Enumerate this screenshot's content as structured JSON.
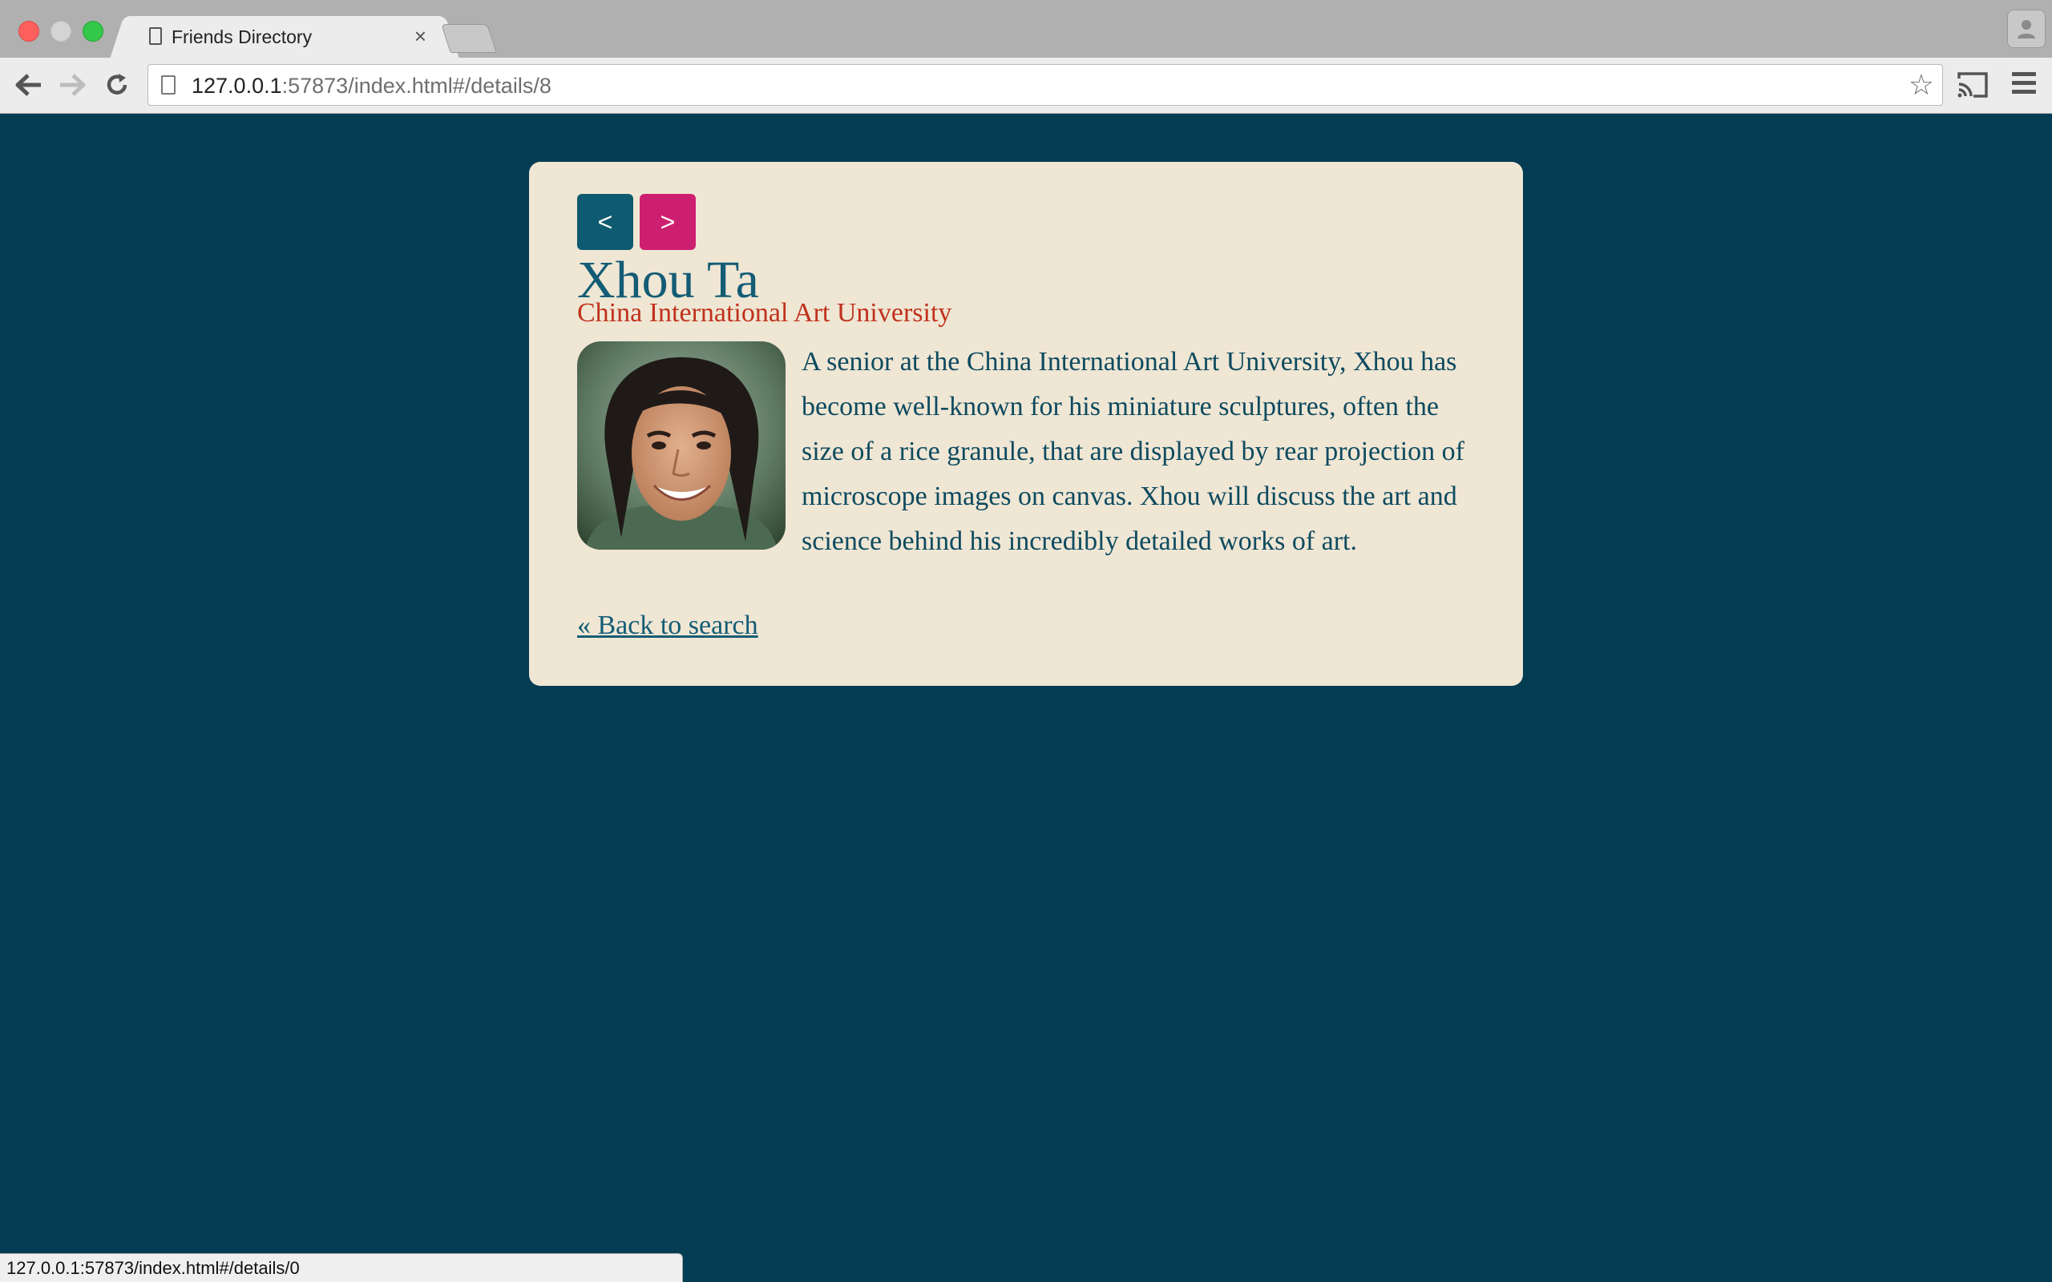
{
  "browser": {
    "tab_title": "Friends Directory",
    "tab_close": "×",
    "url_host": "127.0.0.1",
    "url_rest": ":57873/index.html#/details/8",
    "status_url": "127.0.0.1:57873/index.html#/details/0"
  },
  "detail": {
    "prev_label": "<",
    "next_label": ">",
    "name": "Xhou Ta",
    "school": "China International Art University",
    "bio": "A senior at the China International Art University, Xhou has become well-known for his miniature sculptures, often the size of a rice granule, that are displayed by rear projection of microscope images on canvas. Xhou will discuss the art and science behind his incredibly detailed works of art.",
    "back_link": "« Back to search"
  },
  "colors": {
    "page_background": "#043c53",
    "card_background": "#efe6d4",
    "prev_button": "#0e5a70",
    "next_button": "#cd1f70",
    "name_color": "#135c75",
    "school_color": "#c0311b"
  }
}
